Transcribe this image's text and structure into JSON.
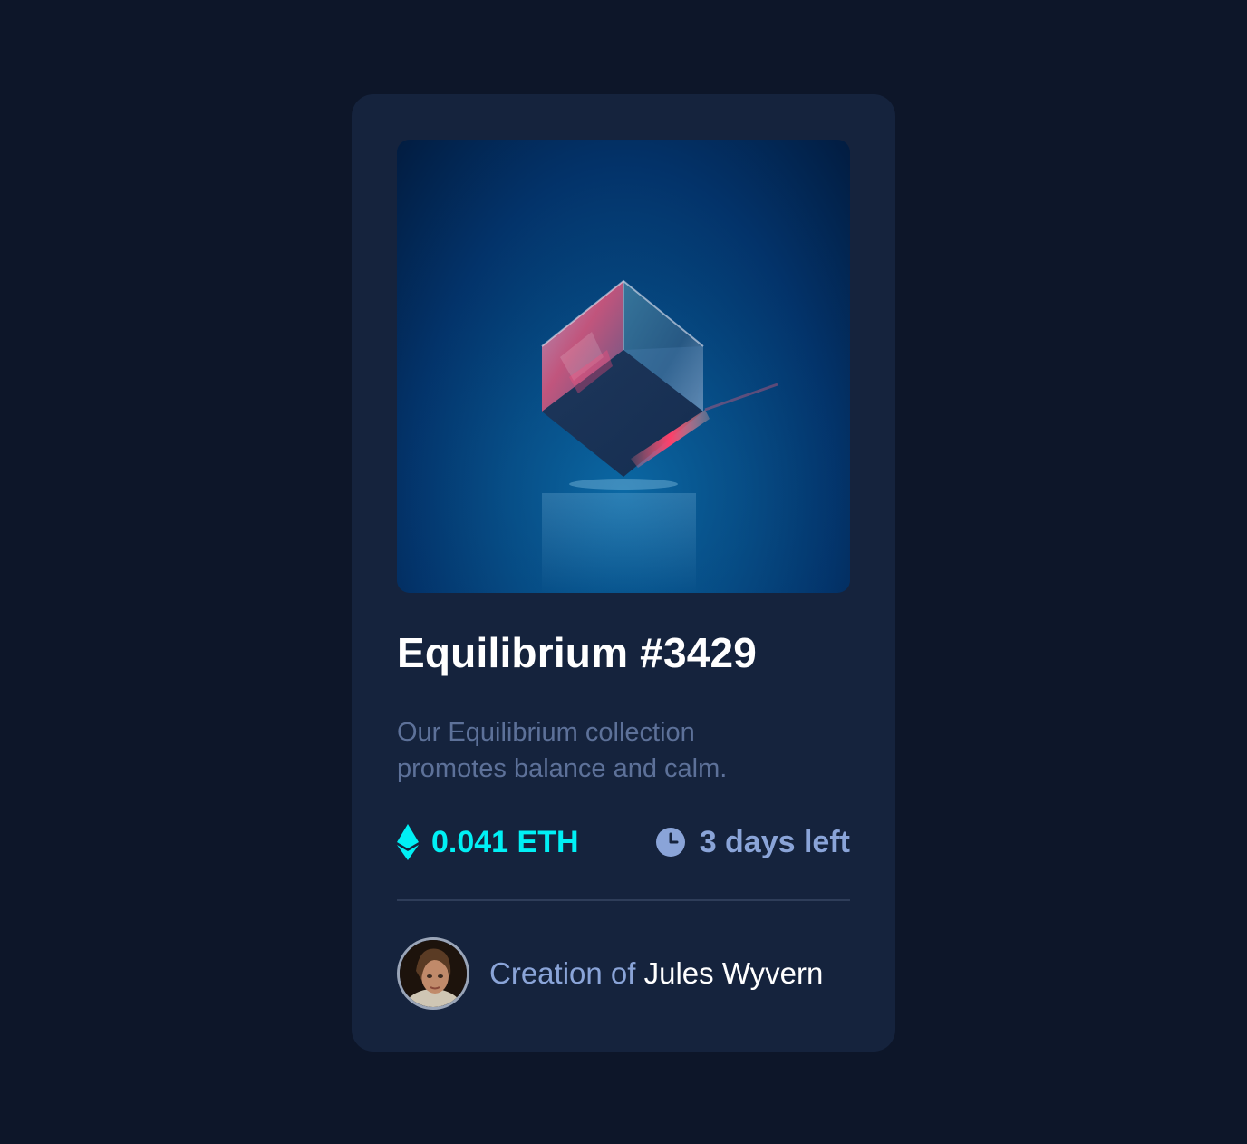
{
  "card": {
    "title": "Equilibrium #3429",
    "description": "Our Equilibrium collection promotes balance and calm.",
    "price": "0.041 ETH",
    "time_left": "3 days left",
    "creator_prefix": "Creation of",
    "creator_name": "Jules Wyvern"
  },
  "icons": {
    "price": "ethereum-icon",
    "time": "clock-icon"
  },
  "colors": {
    "page_background": "#0d1629",
    "card_background": "#15233d",
    "accent_cyan": "#00f0f5",
    "soft_blue": "#8aa4d8",
    "muted_text": "#5d7199",
    "white": "#ffffff"
  }
}
